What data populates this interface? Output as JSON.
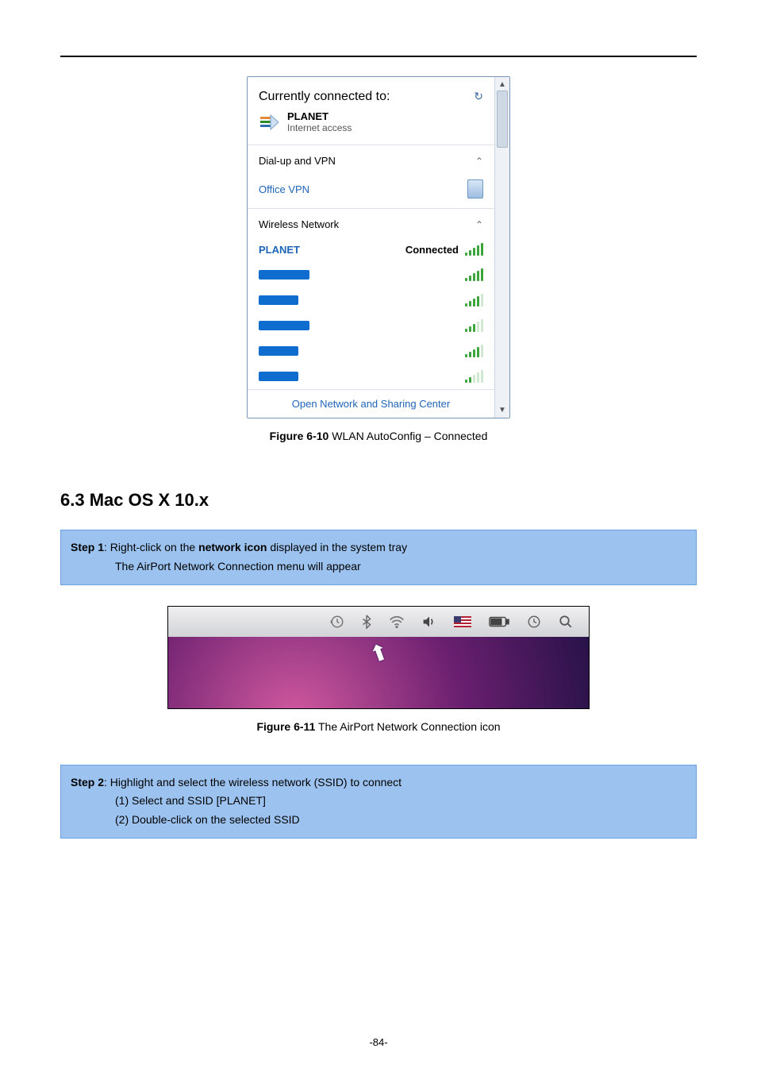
{
  "page_number": "-84-",
  "figures": {
    "wlan": {
      "caption_prefix": "Figure 6-10",
      "caption_text": " WLAN AutoConfig – Connected",
      "header": "Currently connected to:",
      "network_name": "PLANET",
      "network_status": "Internet access",
      "dialup_label": "Dial-up and VPN",
      "vpn_label": "Office VPN",
      "wireless_label": "Wireless Network",
      "connected_ssid": "PLANET",
      "connected_status": "Connected",
      "footer_link": "Open Network and Sharing Center"
    },
    "mac": {
      "caption_prefix": "Figure 6-11",
      "caption_text": " The AirPort Network Connection icon"
    }
  },
  "section_heading": "6.3  Mac OS X 10.x",
  "step1": {
    "label": "Step 1",
    "line1a": ": Right-click on the ",
    "line1b": "network icon",
    "line1c": " displayed in the system tray",
    "line2": "The AirPort Network Connection menu will appear"
  },
  "step2": {
    "label": "Step 2",
    "line1": ": Highlight and select the wireless network (SSID) to connect",
    "item1": "(1)  Select and SSID [PLANET]",
    "item2": "(2)  Double-click on the selected SSID"
  }
}
